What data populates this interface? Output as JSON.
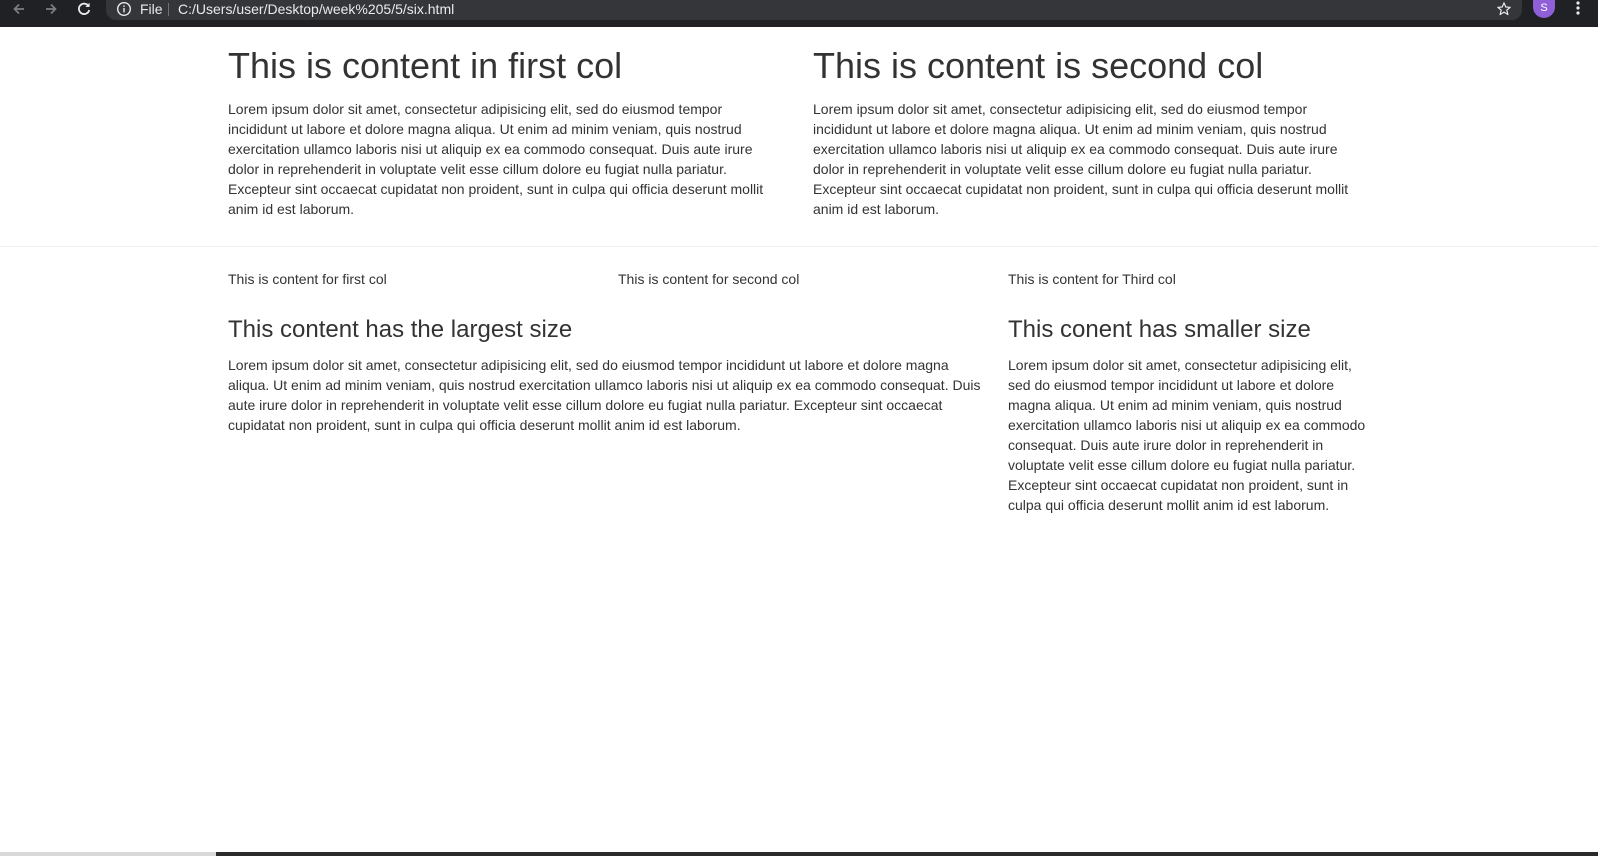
{
  "browser": {
    "scheme_label": "File",
    "url": "C:/Users/user/Desktop/week%205/5/six.html",
    "avatar_initial": "S",
    "colors": {
      "toolbar": "#202124",
      "omnibox": "#35363a",
      "avatar": "#8e5fd6"
    }
  },
  "section1": {
    "col1": {
      "heading": "This is content in first col",
      "body": "Lorem ipsum dolor sit amet, consectetur adipisicing elit, sed do eiusmod tempor incididunt ut labore et dolore magna aliqua. Ut enim ad minim veniam, quis nostrud exercitation ullamco laboris nisi ut aliquip ex ea commodo consequat. Duis aute irure dolor in reprehenderit in voluptate velit esse cillum dolore eu fugiat nulla pariatur. Excepteur sint occaecat cupidatat non proident, sunt in culpa qui officia deserunt mollit anim id est laborum."
    },
    "col2": {
      "heading": "This is content is second col",
      "body": "Lorem ipsum dolor sit amet, consectetur adipisicing elit, sed do eiusmod tempor incididunt ut labore et dolore magna aliqua. Ut enim ad minim veniam, quis nostrud exercitation ullamco laboris nisi ut aliquip ex ea commodo consequat. Duis aute irure dolor in reprehenderit in voluptate velit esse cillum dolore eu fugiat nulla pariatur. Excepteur sint occaecat cupidatat non proident, sunt in culpa qui officia deserunt mollit anim id est laborum."
    }
  },
  "section2": {
    "col1": "This is content for first col",
    "col2": "This is content for second col",
    "col3": "This is content for Third col"
  },
  "section3": {
    "large": {
      "heading": "This content has the largest size",
      "body": "Lorem ipsum dolor sit amet, consectetur adipisicing elit, sed do eiusmod tempor incididunt ut labore et dolore magna aliqua. Ut enim ad minim veniam, quis nostrud exercitation ullamco laboris nisi ut aliquip ex ea commodo consequat. Duis aute irure dolor in reprehenderit in voluptate velit esse cillum dolore eu fugiat nulla pariatur. Excepteur sint occaecat cupidatat non proident, sunt in culpa qui officia deserunt mollit anim id est laborum."
    },
    "small": {
      "heading": "This conent has smaller size",
      "body": "Lorem ipsum dolor sit amet, consectetur adipisicing elit, sed do eiusmod tempor incididunt ut labore et dolore magna aliqua. Ut enim ad minim veniam, quis nostrud exercitation ullamco laboris nisi ut aliquip ex ea commodo consequat. Duis aute irure dolor in reprehenderit in voluptate velit esse cillum dolore eu fugiat nulla pariatur. Excepteur sint occaecat cupidatat non proident, sunt in culpa qui officia deserunt mollit anim id est laborum."
    }
  }
}
